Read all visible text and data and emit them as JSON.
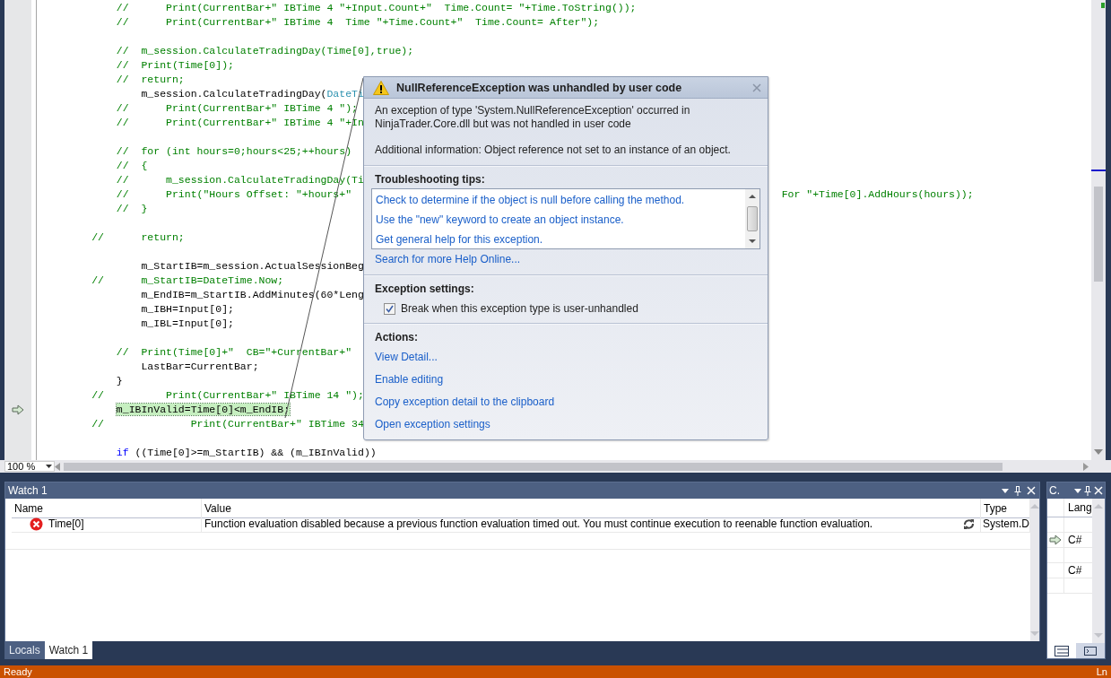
{
  "editor": {
    "blocks": [
      [
        {
          "segments": [
            {
              "kind": "comment",
              "text": "            //      Print(CurrentBar+\" IBTime 4 \"+Input.Count+\"  Time.Count= \"+Time.ToString());"
            }
          ],
          "current": false
        },
        {
          "segments": [
            {
              "kind": "comment",
              "text": "            //      Print(CurrentBar+\" IBTime 4  Time \"+Time.Count+\"  Time.Count= After\");"
            }
          ],
          "current": false
        }
      ],
      [
        {
          "segments": [
            {
              "kind": "comment",
              "text": "            //  m_session.CalculateTradingDay(Time[0],true);"
            }
          ],
          "current": false
        },
        {
          "segments": [
            {
              "kind": "comment",
              "text": "            //  Print(Time[0]);"
            }
          ],
          "current": false
        },
        {
          "segments": [
            {
              "kind": "comment",
              "text": "            //  return;"
            }
          ],
          "current": false
        },
        {
          "segments": [
            {
              "kind": "plain",
              "text": "                m_session.CalculateTradingDay("
            },
            {
              "kind": "type",
              "text": "DateTi"
            }
          ],
          "current": false
        },
        {
          "segments": [
            {
              "kind": "comment",
              "text": "            //      Print(CurrentBar+\" IBTime 4 \");"
            }
          ],
          "current": false
        },
        {
          "segments": [
            {
              "kind": "comment",
              "text": "            //      Print(CurrentBar+\" IBTime 4 \"+In"
            }
          ],
          "current": false
        }
      ],
      [
        {
          "segments": [
            {
              "kind": "comment",
              "text": "            //  for (int hours=0;hours<25;++hours)"
            }
          ],
          "current": false
        },
        {
          "segments": [
            {
              "kind": "comment",
              "text": "            //  {"
            }
          ],
          "current": false
        },
        {
          "segments": [
            {
              "kind": "comment",
              "text": "            //      m_session.CalculateTradingDay(Ti"
            }
          ],
          "current": false
        },
        {
          "segments": [
            {
              "kind": "comment",
              "text": "            //      Print(\"Hours Offset: \"+hours+\""
            }
          ],
          "tail": "For \"+Time[0].AddHours(hours));",
          "current": false
        },
        {
          "segments": [
            {
              "kind": "comment",
              "text": "            //  }"
            }
          ],
          "current": false
        }
      ],
      [
        {
          "segments": [
            {
              "kind": "comment",
              "text": "        //      return;"
            }
          ],
          "current": false
        }
      ],
      [
        {
          "segments": [
            {
              "kind": "plain",
              "text": "                m_StartIB=m_session.ActualSessionBeg"
            }
          ],
          "current": false
        },
        {
          "segments": [
            {
              "kind": "comment",
              "text": "        //      m_StartIB=DateTime.Now;"
            }
          ],
          "current": false
        },
        {
          "segments": [
            {
              "kind": "plain",
              "text": "                m_EndIB=m_StartIB.AddMinutes(60*Leng"
            }
          ],
          "current": false
        },
        {
          "segments": [
            {
              "kind": "plain",
              "text": "                m_IBH=Input[0];"
            }
          ],
          "current": false
        },
        {
          "segments": [
            {
              "kind": "plain",
              "text": "                m_IBL=Input[0];"
            }
          ],
          "current": false
        }
      ],
      [
        {
          "segments": [
            {
              "kind": "comment",
              "text": "            //  Print(Time[0]+\"  CB=\"+CurrentBar+\""
            }
          ],
          "current": false
        },
        {
          "segments": [
            {
              "kind": "plain",
              "text": "                LastBar=CurrentBar;"
            }
          ],
          "current": false
        },
        {
          "segments": [
            {
              "kind": "plain",
              "text": "            }"
            }
          ],
          "current": false
        },
        {
          "segments": [
            {
              "kind": "comment",
              "text": "        //          Print(CurrentBar+\" IBTime 14 \");"
            }
          ],
          "current": false
        },
        {
          "segments": [
            {
              "kind": "plain",
              "text": "            m_IBInValid=Time[0]<m_EndIB;"
            }
          ],
          "current": true
        },
        {
          "segments": [
            {
              "kind": "comment",
              "text": "        //              Print(CurrentBar+\" IBTime 34"
            }
          ],
          "current": false
        }
      ],
      [
        {
          "segments": [
            {
              "kind": "keyword",
              "text": "            if"
            },
            {
              "kind": "plain",
              "text": " ((Time[0]>=m_StartIB) && (m_IBInValid))"
            }
          ],
          "current": false
        }
      ]
    ],
    "zoom": "100 %"
  },
  "exception_popup": {
    "title": "NullReferenceException was unhandled by user code",
    "message": "An exception of type 'System.NullReferenceException' occurred in NinjaTrader.Core.dll but was not handled in user code",
    "additional_info": "Additional information: Object reference not set to an instance of an object.",
    "tips_heading": "Troubleshooting tips:",
    "tips": [
      "Check to determine if the object is null before calling the method.",
      "Use the \"new\" keyword to create an object instance.",
      "Get general help for this exception."
    ],
    "search_link": "Search for more Help Online...",
    "settings_heading": "Exception settings:",
    "break_checkbox": {
      "label": "Break when this exception type is user-unhandled",
      "checked": true
    },
    "actions_heading": "Actions:",
    "actions": [
      "View Detail...",
      "Enable editing",
      "Copy exception detail to the clipboard",
      "Open exception settings"
    ]
  },
  "watch_panel": {
    "title": "Watch 1",
    "columns": [
      "Name",
      "Value",
      "Type"
    ],
    "rows": [
      {
        "name": "Time[0]",
        "value": "Function evaluation disabled because a previous function evaluation timed out. You must continue execution to reenable function evaluation.",
        "type": "System.D",
        "error": true
      }
    ]
  },
  "call_stack_panel": {
    "title": "C.",
    "column": "Lang",
    "rows": [
      {
        "language": "C#",
        "current": true
      },
      {
        "language": "C#",
        "current": false
      }
    ]
  },
  "bottom_tabs": [
    {
      "label": "Locals",
      "selected": false
    },
    {
      "label": "Watch 1",
      "selected": true
    }
  ],
  "status_bar": {
    "left": "Ready",
    "right": "Ln"
  }
}
